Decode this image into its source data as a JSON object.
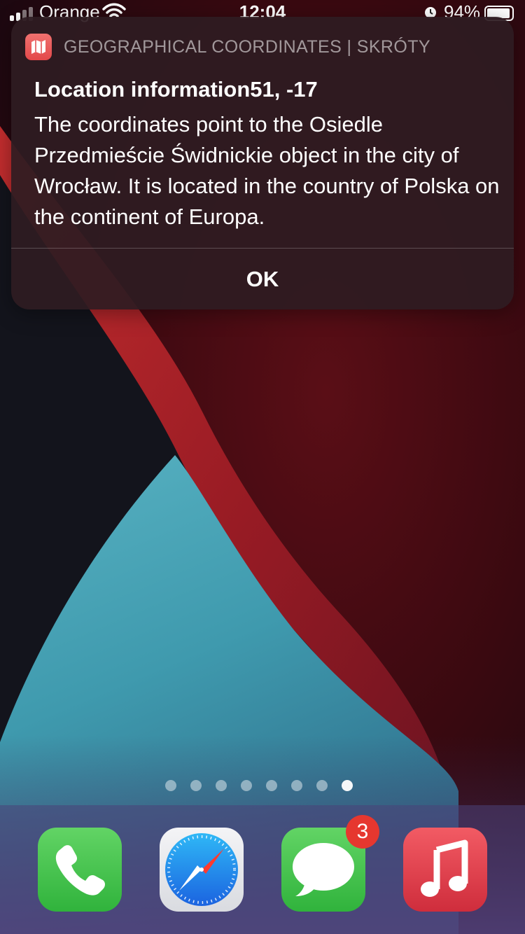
{
  "status_bar": {
    "carrier": "Orange",
    "time": "12:04",
    "battery_percent": "94%",
    "battery_level": 0.94,
    "icons": [
      "signal-icon",
      "wifi-icon",
      "alarm-icon",
      "battery-icon"
    ]
  },
  "alert": {
    "app_name": "GEOGRAPHICAL COORDINATES | SKRÓTY",
    "app_icon": "map-icon",
    "title": "Location information51, -17",
    "body": "The coordinates point to the Osiedle Przedmieście Świdnickie object in the city of Wrocław. It is located in the country of Polska on the continent of Europa.",
    "ok_label": "OK"
  },
  "home": {
    "page_count": 8,
    "active_page": 8
  },
  "dock": {
    "apps": [
      {
        "name": "Phone",
        "icon": "phone-icon"
      },
      {
        "name": "Safari",
        "icon": "safari-icon"
      },
      {
        "name": "Messages",
        "icon": "messages-icon",
        "badge": "3"
      },
      {
        "name": "Music",
        "icon": "music-icon"
      }
    ]
  },
  "colors": {
    "alert_background": "#2e1c21",
    "badge": "#e6372f",
    "maps_icon": "#e3484a",
    "wallpaper_red": "#b8242a",
    "wallpaper_teal": "#3aa0b0"
  }
}
